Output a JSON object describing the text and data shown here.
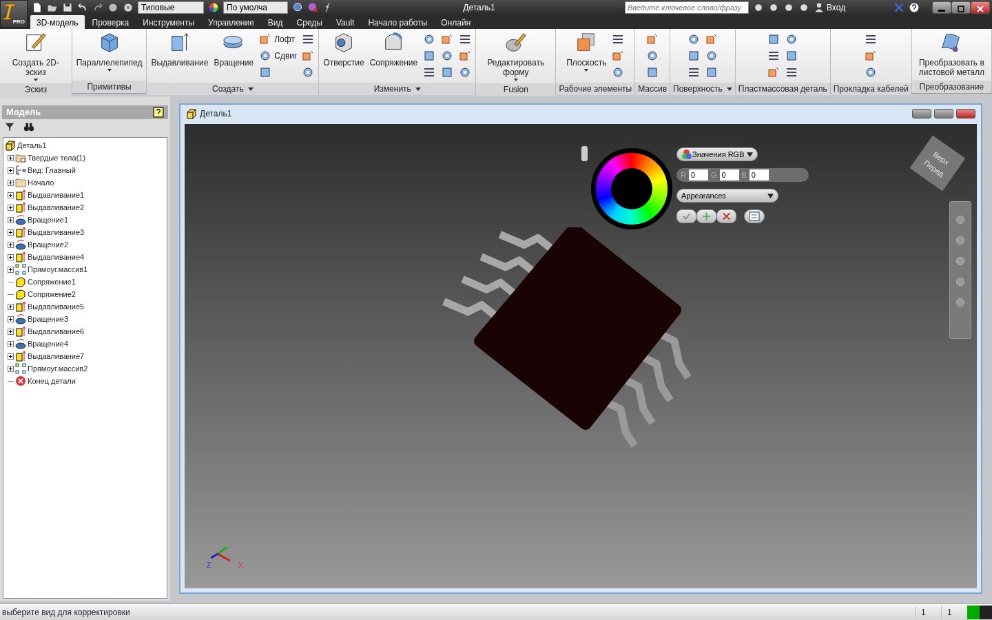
{
  "title_bar": {
    "app_badge": "PRO",
    "style_dropdown": "Типовые",
    "material_dropdown": "По умолча",
    "title": "Деталь1",
    "search": {
      "placeholder": "Введите ключевое слово/фразу"
    },
    "sign_in": "Вход"
  },
  "ribbon_tabs": [
    {
      "label": "3D-модель",
      "selected": true
    },
    {
      "label": "Проверка",
      "selected": false
    },
    {
      "label": "Инструменты",
      "selected": false
    },
    {
      "label": "Управление",
      "selected": false
    },
    {
      "label": "Вид",
      "selected": false
    },
    {
      "label": "Среды",
      "selected": false
    },
    {
      "label": "Vault",
      "selected": false
    },
    {
      "label": "Начало работы",
      "selected": false
    },
    {
      "label": "Онлайн",
      "selected": false
    }
  ],
  "ribbon_panels": [
    {
      "title": "Эскиз",
      "menu": false,
      "large": [
        {
          "label": "Создать 2D-эскиз",
          "dropdown": true,
          "kind": "sketch"
        }
      ]
    },
    {
      "title": "Примитивы",
      "menu": false,
      "large": [
        {
          "label": "Параллелепипед",
          "dropdown": true,
          "kind": "box"
        }
      ]
    },
    {
      "title": "Создать",
      "menu": true,
      "large": [
        {
          "label": "Выдавливание",
          "dropdown": false,
          "kind": "extrude"
        },
        {
          "label": "Вращение",
          "dropdown": false,
          "kind": "revolve"
        }
      ],
      "small": [
        {
          "kind": "labeled",
          "label": "Лофт"
        },
        {
          "kind": "labeled",
          "label": "Сдвиг"
        },
        {
          "kind": "icon"
        },
        {
          "kind": "icon"
        },
        {
          "kind": "icon"
        },
        {
          "kind": "icon"
        }
      ]
    },
    {
      "title": "Изменить",
      "menu": true,
      "large": [
        {
          "label": "Отверстие",
          "dropdown": false,
          "kind": "hole"
        },
        {
          "label": "Сопряжение",
          "dropdown": false,
          "kind": "fillet"
        }
      ],
      "small": [
        {
          "kind": "icon"
        },
        {
          "kind": "icon"
        },
        {
          "kind": "icon"
        },
        {
          "kind": "icon"
        },
        {
          "kind": "icon"
        },
        {
          "kind": "icon"
        },
        {
          "kind": "icon"
        },
        {
          "kind": "icon"
        },
        {
          "kind": "icon"
        }
      ]
    },
    {
      "title": "Fusion",
      "menu": false,
      "large": [
        {
          "label": "Редактировать форму",
          "dropdown": true,
          "kind": "fusion"
        }
      ]
    },
    {
      "title": "Рабочие элементы",
      "menu": false,
      "large": [
        {
          "label": "Плоскость",
          "dropdown": true,
          "kind": "plane"
        }
      ],
      "small": [
        {
          "kind": "icon"
        },
        {
          "kind": "icon"
        },
        {
          "kind": "icon"
        }
      ]
    },
    {
      "title": "Массив",
      "menu": false,
      "small": [
        {
          "kind": "icon"
        },
        {
          "kind": "icon"
        },
        {
          "kind": "icon"
        }
      ]
    },
    {
      "title": "Поверхность",
      "menu": true,
      "small": [
        {
          "kind": "icon"
        },
        {
          "kind": "icon"
        },
        {
          "kind": "icon"
        },
        {
          "kind": "icon"
        },
        {
          "kind": "icon"
        },
        {
          "kind": "icon"
        }
      ]
    },
    {
      "title": "Пластмассовая деталь",
      "menu": false,
      "small": [
        {
          "kind": "icon"
        },
        {
          "kind": "icon"
        },
        {
          "kind": "icon"
        },
        {
          "kind": "icon"
        },
        {
          "kind": "icon"
        },
        {
          "kind": "icon"
        }
      ]
    },
    {
      "title": "Прокладка кабелей",
      "menu": false,
      "small": [
        {
          "kind": "icon"
        },
        {
          "kind": "icon"
        },
        {
          "kind": "icon"
        }
      ]
    },
    {
      "title": "Преобразование",
      "menu": false,
      "large": [
        {
          "label": "Преобразовать в листовой металл",
          "dropdown": false,
          "kind": "sheet"
        }
      ]
    }
  ],
  "browser": {
    "title": "Модель",
    "model_tree": {
      "label": "Деталь1",
      "kind": "part",
      "children": [
        {
          "label": "Твердые тела(1)",
          "kind": "bodies",
          "expander": true
        },
        {
          "label": "Вид: Главный",
          "kind": "view",
          "expander": true
        },
        {
          "label": "Начало",
          "kind": "folder",
          "expander": true
        },
        {
          "label": "Выдавливание1",
          "kind": "extrude",
          "expander": true
        },
        {
          "label": "Выдавливание2",
          "kind": "extrude",
          "expander": true
        },
        {
          "label": "Вращение1",
          "kind": "revolve",
          "expander": true
        },
        {
          "label": "Выдавливание3",
          "kind": "extrude",
          "expander": true
        },
        {
          "label": "Вращение2",
          "kind": "revolve",
          "expander": true
        },
        {
          "label": "Выдавливание4",
          "kind": "extrude",
          "expander": true
        },
        {
          "label": "Прямоуг.массив1",
          "kind": "pattern",
          "expander": true
        },
        {
          "label": "Сопряжение1",
          "kind": "fillet",
          "expander": false
        },
        {
          "label": "Сопряжение2",
          "kind": "fillet",
          "expander": false
        },
        {
          "label": "Выдавливание5",
          "kind": "extrude",
          "expander": true
        },
        {
          "label": "Вращение3",
          "kind": "revolve",
          "expander": true
        },
        {
          "label": "Выдавливание6",
          "kind": "extrude",
          "expander": true
        },
        {
          "label": "Вращение4",
          "kind": "revolve",
          "expander": true
        },
        {
          "label": "Выдавливание7",
          "kind": "extrude",
          "expander": true
        },
        {
          "label": "Прямоуг.массив2",
          "kind": "pattern",
          "expander": true
        },
        {
          "label": "Конец детали",
          "kind": "end",
          "expander": false
        }
      ]
    }
  },
  "document": {
    "title": "Деталь1",
    "color_picker": {
      "mode": "Значения RGB",
      "channels": [
        {
          "label": "R",
          "value": "0"
        },
        {
          "label": "G",
          "value": "0"
        },
        {
          "label": "B",
          "value": "0"
        }
      ],
      "library": "Appearances"
    },
    "view_cube": {
      "top": "Верх",
      "front": "Перед"
    },
    "triad": {
      "x": "X",
      "z": "Z"
    }
  },
  "status_bar": {
    "message": "выберите вид для корректировки",
    "fields": [
      "1",
      "1"
    ]
  }
}
